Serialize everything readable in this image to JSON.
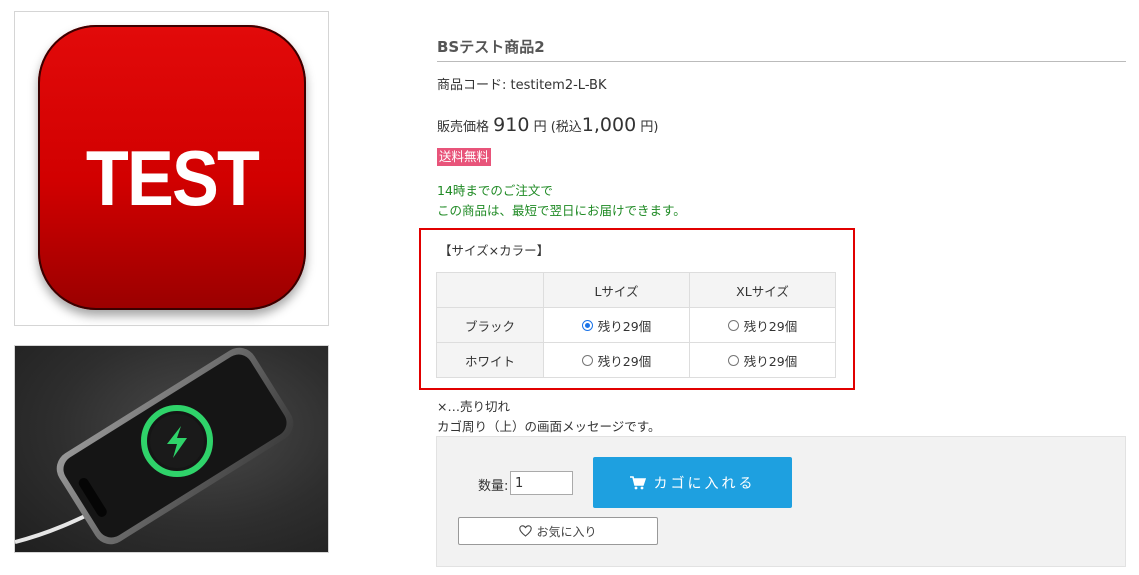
{
  "images": {
    "main_logo_text": "TEST"
  },
  "product": {
    "title": "BSテスト商品2",
    "code_label": "商品コード: testitem2-L-BK",
    "price_label": "販売価格",
    "price": "910",
    "price_unit": "円",
    "tax_open": "(税込",
    "tax_price": "1,000",
    "tax_close": "円)",
    "free_shipping_badge": "送料無料",
    "shipping_line1": "14時までのご注文で",
    "shipping_line2": "この商品は、最短で翌日にお届けできます。"
  },
  "variation": {
    "title": "【サイズ×カラー】",
    "columns": [
      "Lサイズ",
      "XLサイズ"
    ],
    "rows": [
      {
        "label": "ブラック",
        "cells": [
          "残り29個",
          "残り29個"
        ],
        "selected": 0
      },
      {
        "label": "ホワイト",
        "cells": [
          "残り29個",
          "残り29個"
        ],
        "selected": -1
      }
    ]
  },
  "notes": {
    "soldout": "×…売り切れ",
    "cart_message": "カゴ周り（上）の画面メッセージです。"
  },
  "cart": {
    "qty_label": "数量:",
    "qty_value": "1",
    "add_button": "カゴに入れる",
    "favorite_button": "お気に入り"
  },
  "colors": {
    "accent_blue": "#1ea0e0",
    "badge_pink": "#e8547a",
    "highlight_red": "#e10000",
    "shipping_green": "#1f8a24"
  }
}
